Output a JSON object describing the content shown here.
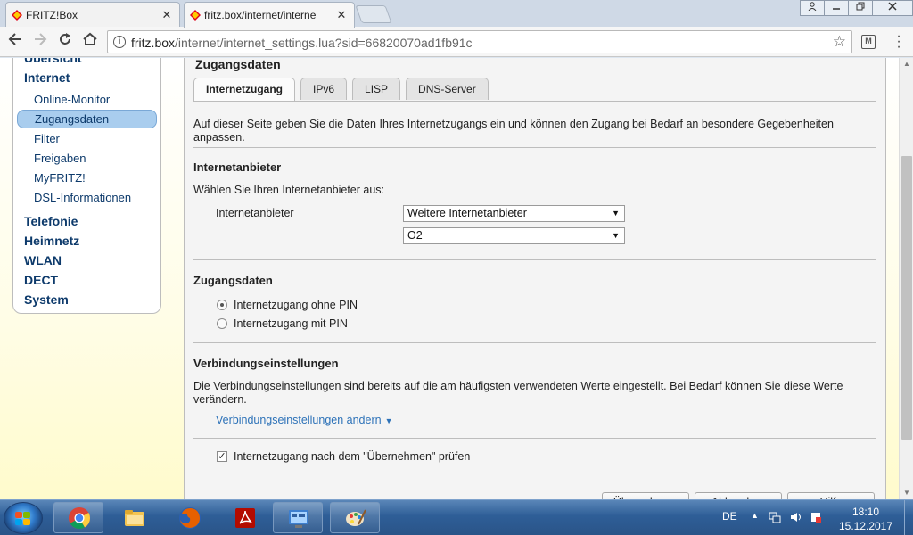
{
  "browser": {
    "tabs": [
      {
        "title": "FRITZ!Box",
        "close": "✕"
      },
      {
        "title": "fritz.box/internet/interne",
        "close": "✕"
      }
    ],
    "url_host": "fritz.box",
    "url_path": "/internet/internet_settings.lua?sid=66820070ad1fb91c"
  },
  "leftnav": {
    "cut_item": "Übersicht",
    "items": [
      "Internet",
      "Telefonie",
      "Heimnetz",
      "WLAN",
      "DECT",
      "System"
    ],
    "sub_items": [
      "Online-Monitor",
      "Zugangsdaten",
      "Filter",
      "Freigaben",
      "MyFRITZ!",
      "DSL-Informationen"
    ]
  },
  "content": {
    "cut_heading": "Zugangsdaten",
    "tabs": [
      "Internetzugang",
      "IPv6",
      "LISP",
      "DNS-Server"
    ],
    "intro": "Auf dieser Seite geben Sie die Daten Ihres Internetzugangs ein und können den Zugang bei Bedarf an besondere Gegebenheiten anpassen.",
    "provider": {
      "heading": "Internetanbieter",
      "prompt": "Wählen Sie Ihren Internetanbieter aus:",
      "label": "Internetanbieter",
      "select1": "Weitere Internetanbieter",
      "select2": "O2"
    },
    "access": {
      "heading": "Zugangsdaten",
      "radio1": "Internetzugang ohne PIN",
      "radio2": "Internetzugang mit PIN"
    },
    "connection": {
      "heading": "Verbindungseinstellungen",
      "text": "Die Verbindungseinstellungen sind bereits auf die am häufigsten verwendeten Werte eingestellt. Bei Bedarf können Sie diese Werte verändern.",
      "link": "Verbindungseinstellungen ändern",
      "link_arrow": "▼"
    },
    "check_label": "Internetzugang nach dem \"Übernehmen\" prüfen",
    "buttons": [
      "Übernehmen",
      "Abbrechen",
      "Hilfe"
    ]
  },
  "taskbar": {
    "lang": "DE",
    "time": "18:10",
    "date": "15.12.2017"
  },
  "colors": {
    "nav_text": "#0d3a6b",
    "nav_selected": "#a9cdee",
    "link": "#2d72b8",
    "panel_top": "#8fb8df"
  }
}
